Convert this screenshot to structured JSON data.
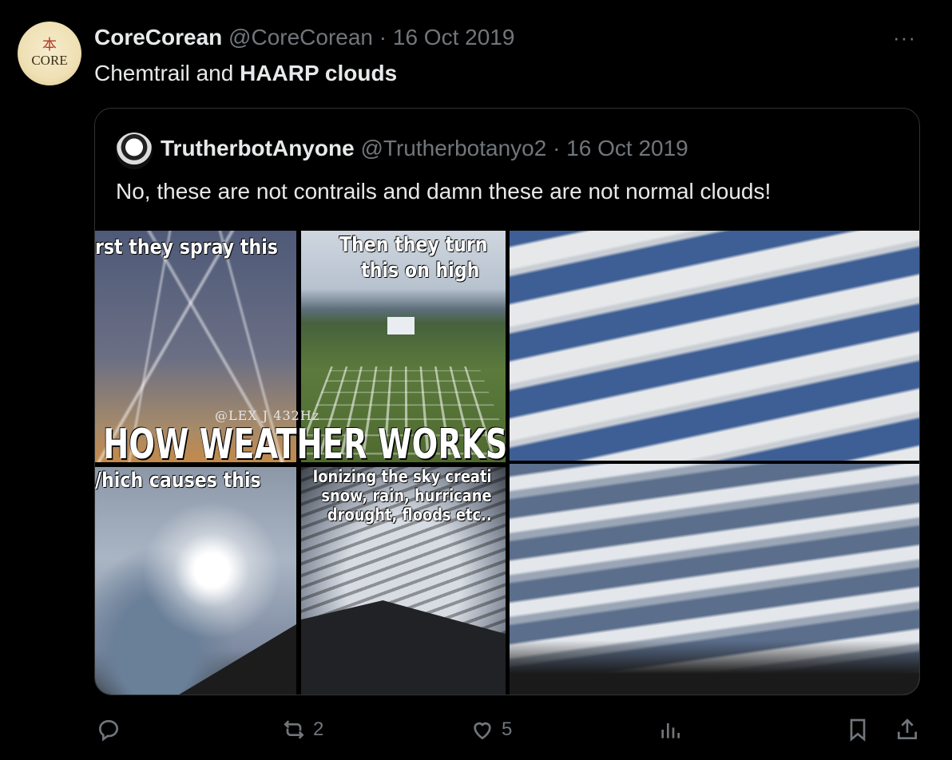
{
  "tweet": {
    "author_name": "CoreCorean",
    "author_meta": "@CoreCorean · 16 Oct 2019",
    "avatar_kanji": "本",
    "avatar_text": "CORE",
    "text_plain": "Chemtrail and ",
    "text_bold": "HAARP clouds",
    "more_label": "···"
  },
  "quote": {
    "author_name": "TrutherbotAnyone",
    "author_meta": "@Trutherbotanyo2 · 16 Oct 2019",
    "text": "No, these are not contrails and damn these are not normal clouds!",
    "meme": {
      "top_left": "rst they spray this",
      "top_right_1": "Then they turn",
      "top_right_2": "this on high",
      "watermark": "@LEX J 432Hz",
      "headline": "HOW WEATHER WORKS",
      "bottom_left": "/hich causes this",
      "bottom_right_1": "Ionizing the sky creati",
      "bottom_right_2": "snow, rain, hurricane",
      "bottom_right_3": "drought, floods etc.."
    }
  },
  "actions": {
    "reply_icon": "reply-icon",
    "retweet_count": "2",
    "like_count": "5",
    "views_icon": "views-icon",
    "bookmark_icon": "bookmark-icon",
    "share_icon": "share-icon"
  }
}
